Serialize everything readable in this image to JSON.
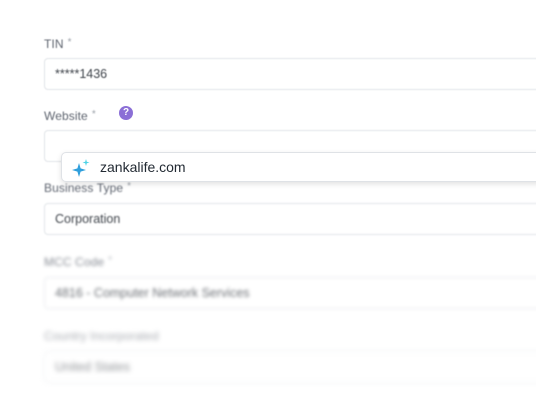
{
  "form": {
    "tin": {
      "label": "TIN",
      "required_mark": "*",
      "value": "*****1436"
    },
    "website": {
      "label": "Website",
      "required_mark": "*",
      "help_icon": "question-icon",
      "help_glyph": "?",
      "value": "",
      "suggestion": {
        "icon": "sparkle-icon",
        "text": "zankalife.com"
      }
    },
    "business_type": {
      "label": "Business Type",
      "required_mark": "*",
      "value": "Corporation"
    },
    "mcc_code": {
      "label": "MCC Code",
      "required_mark": "*",
      "value": "4816 - Computer Network Services"
    },
    "country_incorporated": {
      "label": "Country Incorporated",
      "value": "United States"
    }
  },
  "colors": {
    "help_icon": "#8b6fd6",
    "sparkle_blue": "#2f9fdc",
    "sparkle_cyan": "#4fd3e6"
  }
}
